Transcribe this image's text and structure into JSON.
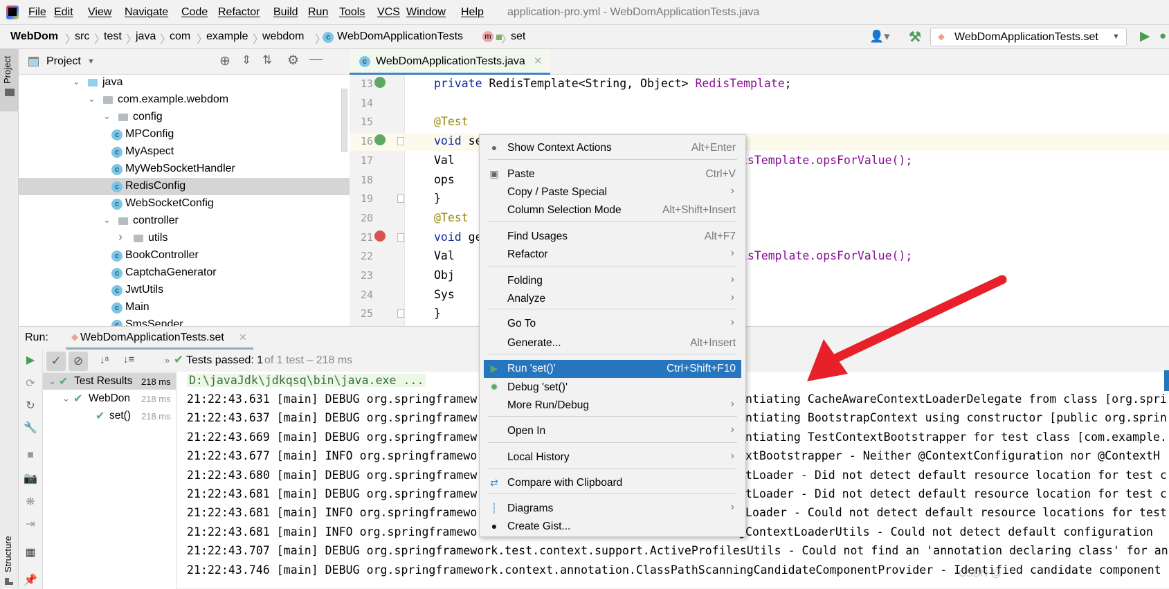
{
  "menubar": {
    "items": [
      "File",
      "Edit",
      "View",
      "Navigate",
      "Code",
      "Refactor",
      "Build",
      "Run",
      "Tools",
      "VCS",
      "Window",
      "Help"
    ],
    "title": "application-pro.yml - WebDomApplicationTests.java"
  },
  "breadcrumb": [
    "WebDom",
    "src",
    "test",
    "java",
    "com",
    "example",
    "webdom",
    "WebDomApplicationTests",
    "set"
  ],
  "toolbar": {
    "run_config": "WebDomApplicationTests.set"
  },
  "project": {
    "title": "Project",
    "strip_label": "Project",
    "structure_label": "Structure",
    "tree": [
      {
        "label": "java",
        "type": "folder-blue",
        "expanded": true
      },
      {
        "label": "com.example.webdom",
        "type": "package",
        "expanded": true
      },
      {
        "label": "config",
        "type": "package",
        "expanded": true
      },
      {
        "label": "MPConfig",
        "type": "class"
      },
      {
        "label": "MyAspect",
        "type": "class"
      },
      {
        "label": "MyWebSocketHandler",
        "type": "class"
      },
      {
        "label": "RedisConfig",
        "type": "class",
        "selected": true
      },
      {
        "label": "WebSocketConfig",
        "type": "class"
      },
      {
        "label": "controller",
        "type": "package",
        "expanded": true
      },
      {
        "label": "utils",
        "type": "package",
        "expanded": false
      },
      {
        "label": "BookController",
        "type": "class"
      },
      {
        "label": "CaptchaGenerator",
        "type": "class"
      },
      {
        "label": "JwtUtils",
        "type": "class"
      },
      {
        "label": "Main",
        "type": "class-main"
      },
      {
        "label": "SmsSender",
        "type": "class"
      }
    ]
  },
  "editor": {
    "tab": "WebDomApplicationTests.java",
    "lines": [
      {
        "n": "13",
        "parts": [
          [
            "kw",
            "private "
          ],
          [
            "",
            "RedisTemplate<String, Object> "
          ],
          [
            "fld",
            "RedisTemplate"
          ],
          [
            "",
            ";"
          ]
        ]
      },
      {
        "n": "14",
        "parts": []
      },
      {
        "n": "15",
        "parts": [
          [
            "ann",
            "@Test"
          ]
        ]
      },
      {
        "n": "16",
        "parts": [
          [
            "kw",
            "void "
          ],
          [
            "",
            "se"
          ]
        ]
      },
      {
        "n": "17",
        "parts": [
          [
            "",
            "    Val"
          ]
        ],
        "right": "isTemplate.opsForValue();"
      },
      {
        "n": "18",
        "parts": [
          [
            "",
            "    ops"
          ]
        ]
      },
      {
        "n": "19",
        "parts": [
          [
            "",
            "}"
          ]
        ]
      },
      {
        "n": "20",
        "parts": [
          [
            "ann",
            "@Test"
          ]
        ]
      },
      {
        "n": "21",
        "parts": [
          [
            "kw",
            "void "
          ],
          [
            "",
            "ge"
          ]
        ]
      },
      {
        "n": "22",
        "parts": [
          [
            "",
            "    Val"
          ]
        ],
        "right": "isTemplate.opsForValue();"
      },
      {
        "n": "23",
        "parts": [
          [
            "",
            "    Obj"
          ]
        ]
      },
      {
        "n": "24",
        "parts": [
          [
            "",
            "    Sys"
          ]
        ]
      },
      {
        "n": "25",
        "parts": [
          [
            "",
            "}"
          ]
        ]
      }
    ]
  },
  "context_menu": {
    "groups": [
      [
        {
          "label": "Show Context Actions",
          "shortcut": "Alt+Enter",
          "icon": "lightbulb-icon"
        }
      ],
      [
        {
          "label": "Paste",
          "shortcut": "Ctrl+V",
          "icon": "clipboard-icon"
        },
        {
          "label": "Copy / Paste Special",
          "submenu": true
        },
        {
          "label": "Column Selection Mode",
          "shortcut": "Alt+Shift+Insert"
        }
      ],
      [
        {
          "label": "Find Usages",
          "shortcut": "Alt+F7"
        },
        {
          "label": "Refactor",
          "submenu": true
        }
      ],
      [
        {
          "label": "Folding",
          "submenu": true
        },
        {
          "label": "Analyze",
          "submenu": true
        }
      ],
      [
        {
          "label": "Go To",
          "submenu": true
        },
        {
          "label": "Generate...",
          "shortcut": "Alt+Insert"
        }
      ],
      [
        {
          "label": "Run 'set()'",
          "shortcut": "Ctrl+Shift+F10",
          "icon": "run-icon",
          "selected": true
        },
        {
          "label": "Debug 'set()'",
          "icon": "bug-icon"
        },
        {
          "label": "More Run/Debug",
          "submenu": true
        }
      ],
      [
        {
          "label": "Open In",
          "submenu": true
        }
      ],
      [
        {
          "label": "Local History",
          "submenu": true
        }
      ],
      [
        {
          "label": "Compare with Clipboard",
          "icon": "compare-icon"
        }
      ],
      [
        {
          "label": "Diagrams",
          "submenu": true,
          "icon": "diagram-icon"
        },
        {
          "label": "Create Gist...",
          "icon": "github-icon"
        }
      ]
    ]
  },
  "run": {
    "label": "Run:",
    "tab": "WebDomApplicationTests.set",
    "status_bold": "Tests passed: 1",
    "status_rest": " of 1 test – 218 ms",
    "tests": [
      {
        "label": "Test Results",
        "time": "218 ms"
      },
      {
        "label": "WebDon",
        "time": "218 ms"
      },
      {
        "label": "set()",
        "time": "218 ms"
      }
    ],
    "console_cmd": "D:\\javaJdk\\jdkqsq\\bin\\java.exe ...",
    "log": [
      {
        "left": "21:22:43.631 [main] DEBUG org.springframew",
        "right": "antiating CacheAwareContextLoaderDelegate from class [org.spri"
      },
      {
        "left": "21:22:43.637 [main] DEBUG org.springframew",
        "right": "antiating BootstrapContext using constructor [public org.sprin"
      },
      {
        "left": "21:22:43.669 [main] DEBUG org.springframew",
        "right": "antiating TestContextBootstrapper for test class [com.example."
      },
      {
        "left": "21:22:43.677 [main] INFO org.springframewo",
        "right": "extBootstrapper - Neither @ContextConfiguration nor @ContextH"
      },
      {
        "left": "21:22:43.680 [main] DEBUG org.springframew",
        "right": "xtLoader - Did not detect default resource location for test c"
      },
      {
        "left": "21:22:43.681 [main] DEBUG org.springframew",
        "right": "xtLoader - Did not detect default resource location for test c"
      },
      {
        "left": "21:22:43.681 [main] INFO org.springframewo",
        "right": "tLoader - Could not detect default resource locations for test"
      },
      {
        "left": "21:22:43.681 [main] INFO org.springframewo",
        "right": "gContextLoaderUtils - Could not detect default configuration"
      },
      {
        "left": "21:22:43.707 [main] DEBUG org.springframework.test.context.support.ActiveProfilesUtils - Could not find an 'annotation declaring class' for an",
        "right": ""
      },
      {
        "left": "21:22:43.746 [main] DEBUG org.springframework.context.annotation.ClassPathScanningCandidateComponentProvider - Identified candidate component",
        "right": ""
      }
    ]
  },
  "watermark": "CSDN @",
  "colors": {
    "accent": "#2675bf",
    "arrow": "#e8202a",
    "pass": "#59a869"
  }
}
